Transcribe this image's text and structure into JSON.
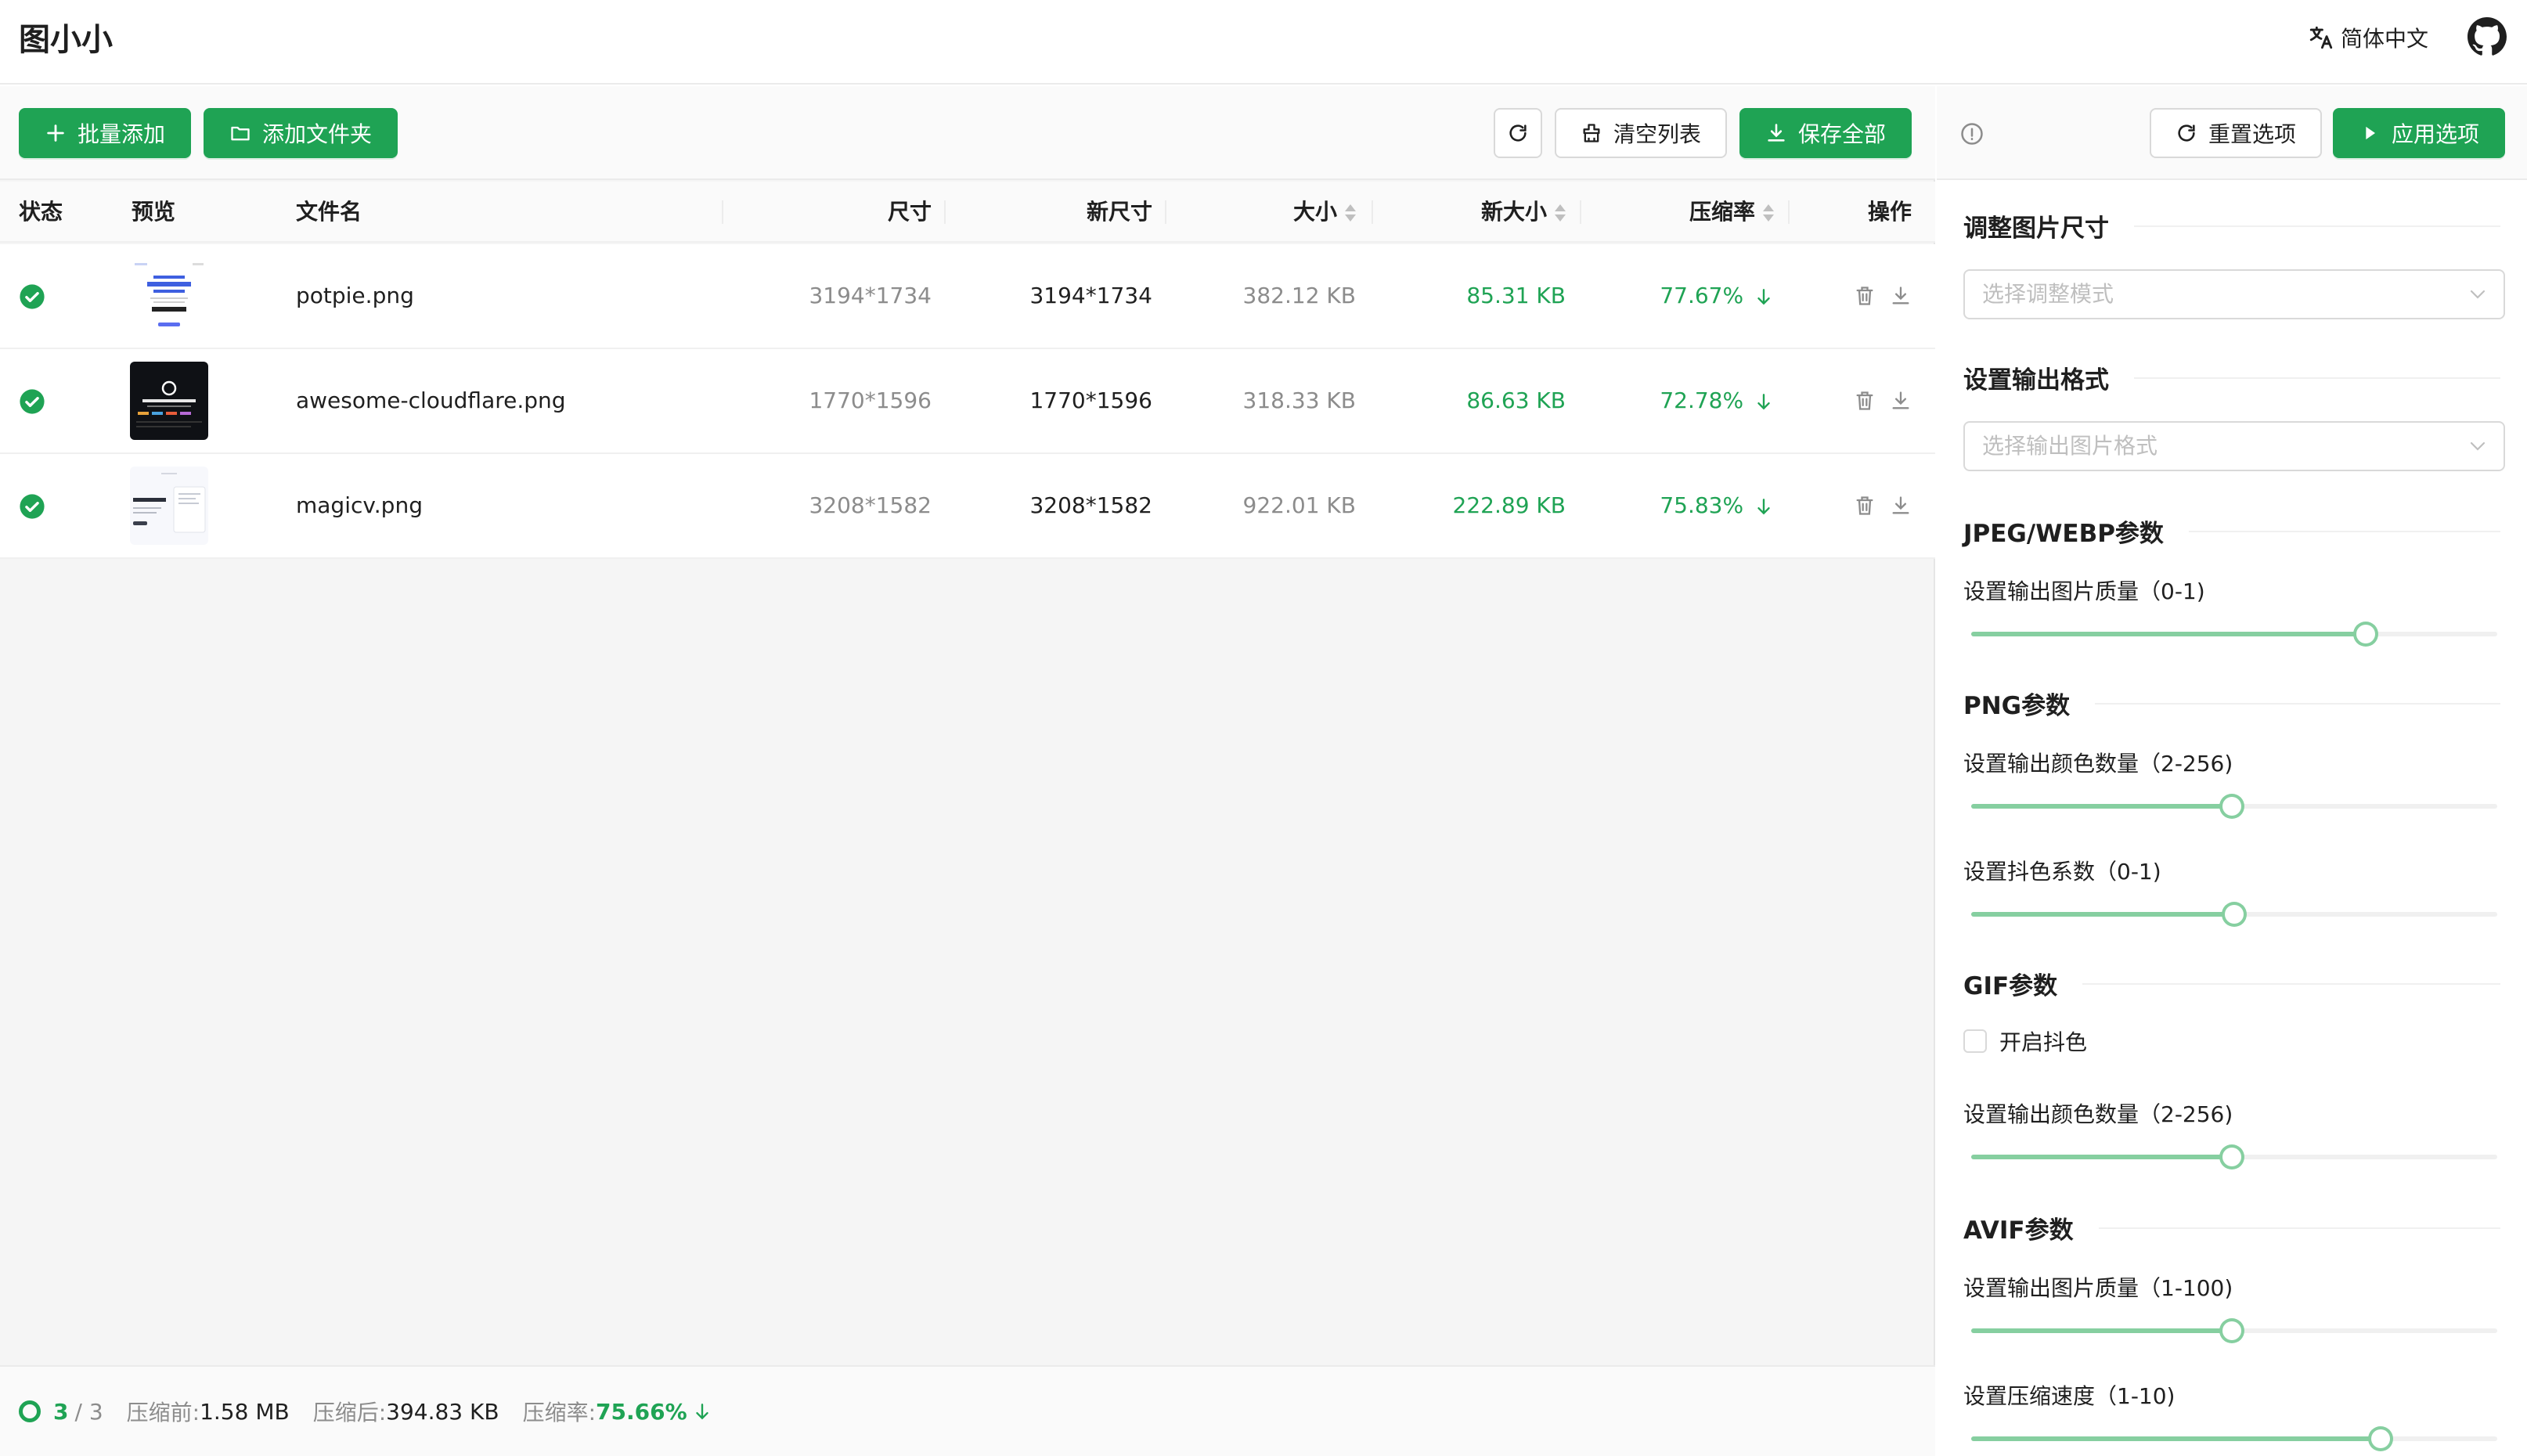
{
  "header": {
    "title": "图小小",
    "language": "简体中文",
    "translate_icon": "translate-icon",
    "github_icon": "github-icon"
  },
  "toolbar": {
    "batch_add": "批量添加",
    "add_folder": "添加文件夹",
    "refresh_icon": "refresh-icon",
    "clear_list": "清空列表",
    "save_all": "保存全部"
  },
  "table": {
    "columns": {
      "status": "状态",
      "preview": "预览",
      "filename": "文件名",
      "dimension": "尺寸",
      "new_dimension": "新尺寸",
      "size": "大小",
      "new_size": "新大小",
      "rate": "压缩率",
      "actions": "操作"
    },
    "rows": [
      {
        "status": "done",
        "filename": "potpie.png",
        "dimension": "3194*1734",
        "new_dimension": "3194*1734",
        "size": "382.12 KB",
        "new_size": "85.31 KB",
        "rate": "77.67%"
      },
      {
        "status": "done",
        "filename": "awesome-cloudflare.png",
        "dimension": "1770*1596",
        "new_dimension": "1770*1596",
        "size": "318.33 KB",
        "new_size": "86.63 KB",
        "rate": "72.78%"
      },
      {
        "status": "done",
        "filename": "magicv.png",
        "dimension": "3208*1582",
        "new_dimension": "3208*1582",
        "size": "922.01 KB",
        "new_size": "222.89 KB",
        "rate": "75.83%"
      }
    ]
  },
  "footer": {
    "done": "3",
    "total": "/ 3",
    "before_label": "压缩前:",
    "before_value": "1.58 MB",
    "after_label": "压缩后:",
    "after_value": "394.83 KB",
    "rate_label": "压缩率:",
    "rate_value": "75.66%"
  },
  "options": {
    "reset": "重置选项",
    "apply": "应用选项",
    "resize_title": "调整图片尺寸",
    "resize_placeholder": "选择调整模式",
    "format_title": "设置输出格式",
    "format_placeholder": "选择输出图片格式",
    "jpeg_title": "JPEG/WEBP参数",
    "jpeg_quality_label": "设置输出图片质量（0-1)",
    "jpeg_quality": 0.75,
    "png_title": "PNG参数",
    "png_colors_label": "设置输出颜色数量（2-256)",
    "png_colors": 128,
    "png_dither_label": "设置抖色系数（0-1)",
    "png_dither": 0.5,
    "gif_title": "GIF参数",
    "gif_dither_label": "开启抖色",
    "gif_dither_enabled": false,
    "gif_colors_label": "设置输出颜色数量（2-256)",
    "gif_colors": 128,
    "avif_title": "AVIF参数",
    "avif_quality_label": "设置输出图片质量（1-100)",
    "avif_quality": 50,
    "avif_speed_label": "设置压缩速度（1-10)",
    "avif_speed": 8
  },
  "colors": {
    "primary": "#1fa354",
    "slider": "#86cfa0",
    "muted": "#8c8c8c"
  }
}
